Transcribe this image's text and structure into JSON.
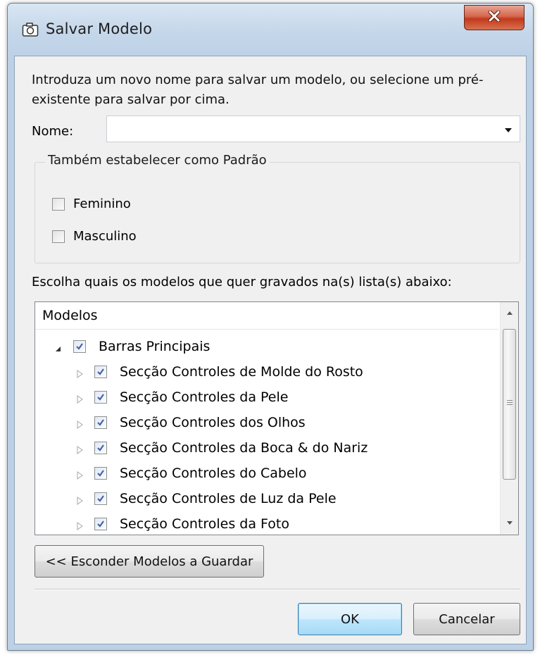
{
  "window": {
    "title": "Salvar Modelo"
  },
  "instructions": "Introduza um novo nome para salvar um modelo, ou selecione um pré-existente para salvar por cima.",
  "name_field": {
    "label": "Nome:",
    "value": ""
  },
  "default_group": {
    "legend": "Também estabelecer como Padrão",
    "options": [
      {
        "label": "Feminino",
        "checked": false
      },
      {
        "label": "Masculino",
        "checked": false
      }
    ]
  },
  "list_label": "Escolha quais os modelos que quer gravados na(s) lista(s) abaixo:",
  "tree": {
    "header": "Modelos",
    "root": {
      "label": "Barras Principais",
      "expanded": true,
      "checked": true
    },
    "children": [
      {
        "label": "Secção Controles de Molde do Rosto",
        "checked": true
      },
      {
        "label": "Secção Controles da Pele",
        "checked": true
      },
      {
        "label": "Secção Controles dos Olhos",
        "checked": true
      },
      {
        "label": "Secção Controles da Boca & do Nariz",
        "checked": true
      },
      {
        "label": "Secção Controles do Cabelo",
        "checked": true
      },
      {
        "label": "Secção Controles de Luz da Pele",
        "checked": true
      },
      {
        "label": "Secção Controles da Foto",
        "checked": true
      }
    ]
  },
  "buttons": {
    "hide": "<< Esconder Modelos a Guardar",
    "ok": "OK",
    "cancel": "Cancelar"
  },
  "icons": {
    "title": "camera-icon",
    "close": "close-icon",
    "dropdown": "chevron-down-icon",
    "expanded": "triangle-down-icon",
    "collapsed": "triangle-right-icon",
    "check": "checkmark-icon"
  },
  "colors": {
    "close_button": "#c7432a",
    "ok_border": "#3c7fb1",
    "check": "#4a63a8"
  }
}
